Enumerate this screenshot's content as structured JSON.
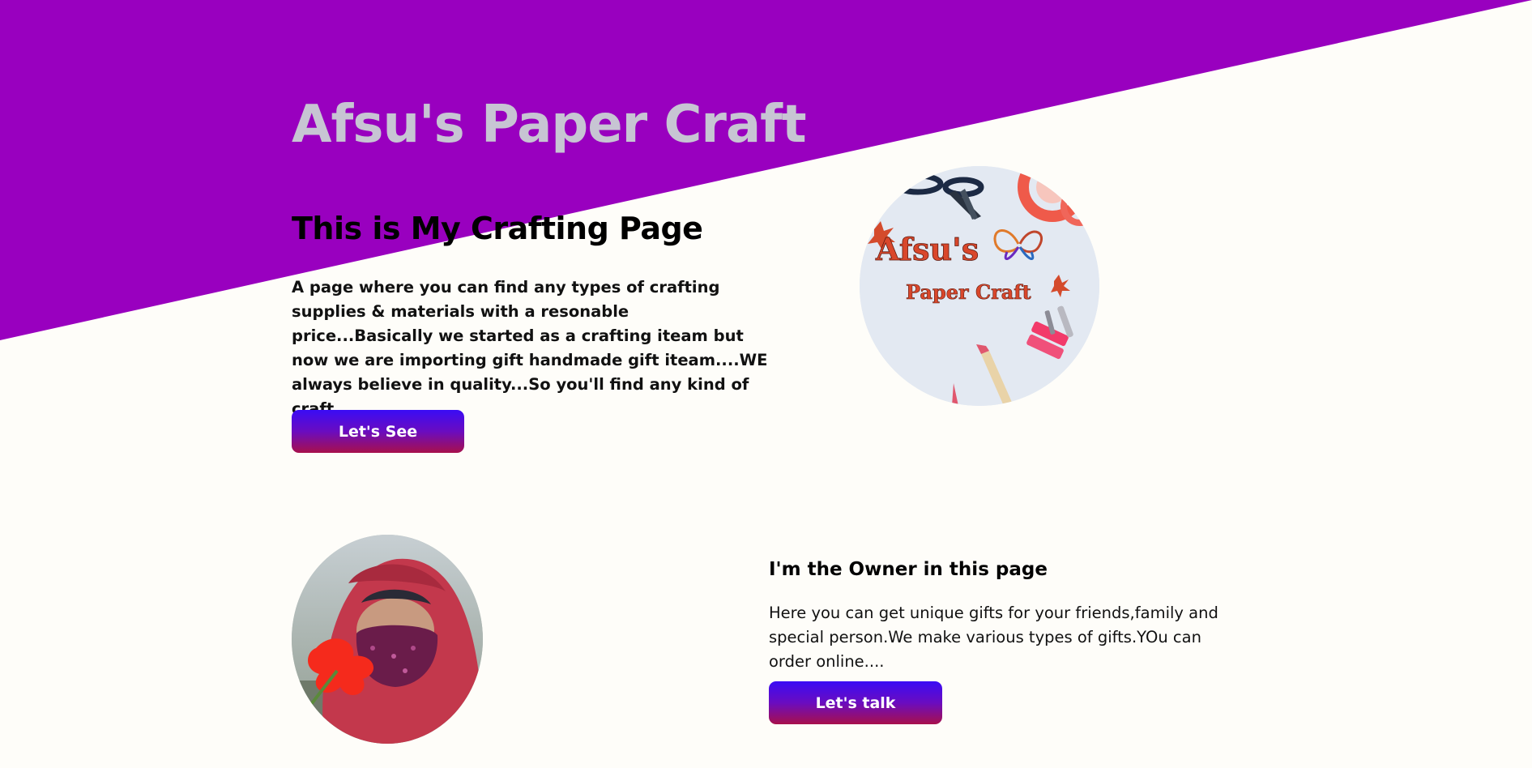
{
  "hero": {
    "title": "Afsu's Paper Craft",
    "subtitle": "This is My Crafting Page",
    "description": "A page where you can find any types of crafting supplies & materials with a resonable price...Basically we started as a crafting iteam but now we are importing gift handmade gift iteam....WE always believe in quality...So you'll find any kind of craft....",
    "button_label": "Let's See",
    "logo_text_line1": "Afsu's",
    "logo_text_line2": "Paper Craft"
  },
  "owner": {
    "title": "I'm the Owner in this page",
    "description": "Here you can get unique gifts for your friends,family and special person.We make various types of gifts.YOu can order online....",
    "button_label": "Let's talk"
  },
  "colors": {
    "hero_band": "#9900bf",
    "page_background": "#fefdf9",
    "title_color": "#c7c5d3",
    "button_gradient_top": "#3a0cf5",
    "button_gradient_bottom": "#a8104c"
  },
  "icons": [
    "scissors-icon",
    "butterfly-icon",
    "flower-icon",
    "pencil-icon",
    "tape-roll-icon",
    "clothespin-icon"
  ]
}
